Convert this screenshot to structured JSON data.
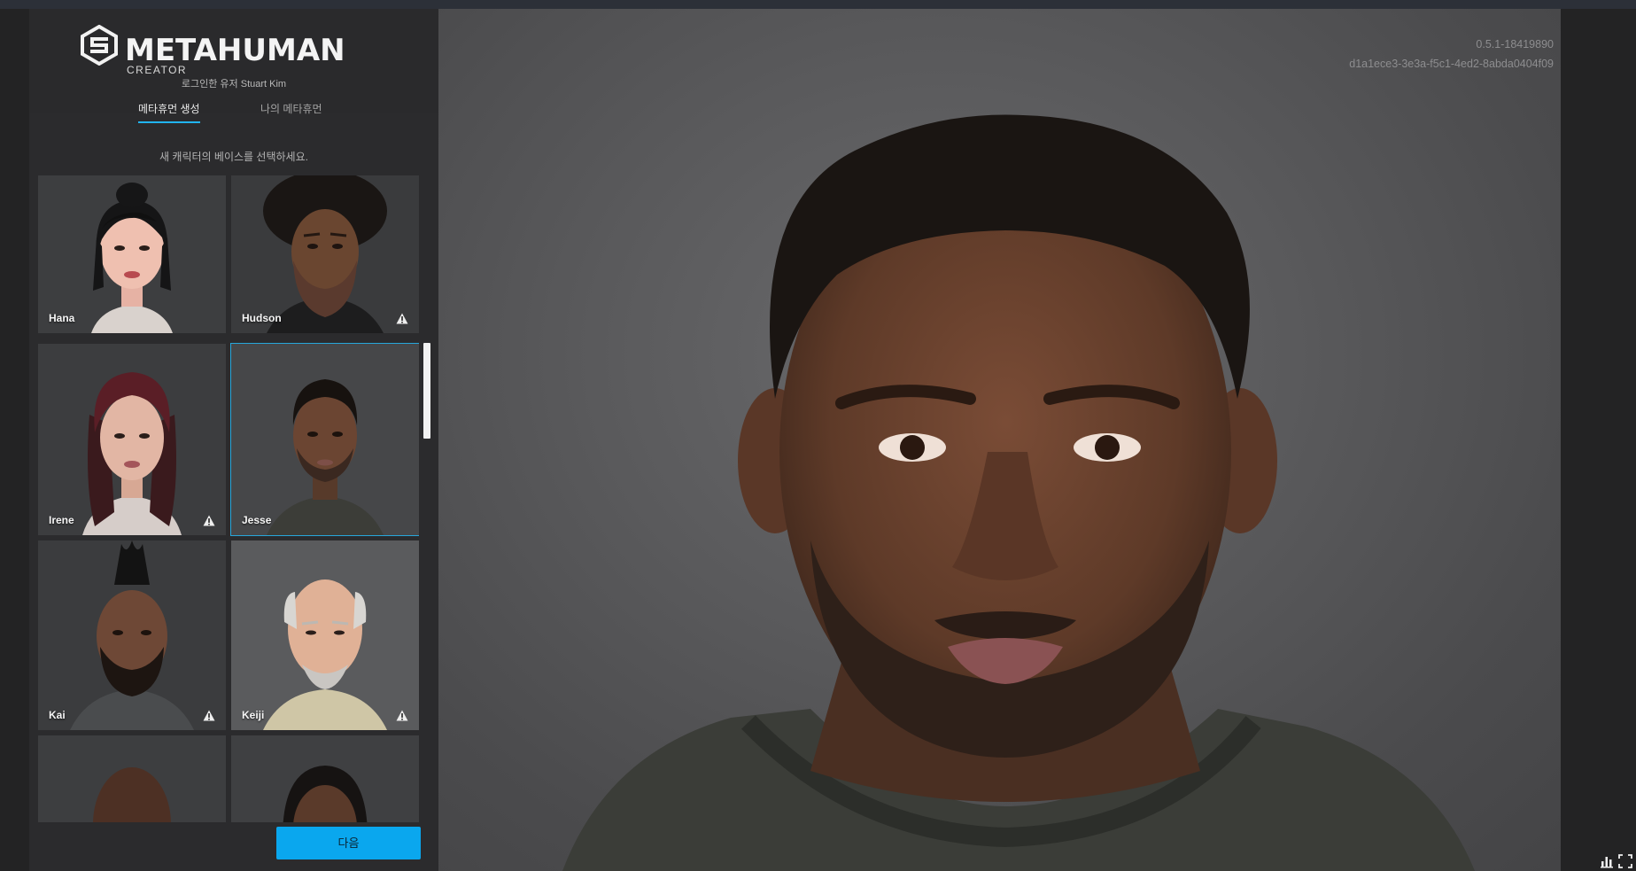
{
  "app": {
    "logo_text": "METAHUMAN",
    "logo_sub": "CREATOR",
    "login_label": "로그인한 유저",
    "user_name": "Stuart Kim"
  },
  "tabs": [
    {
      "label": "메타휴먼 생성",
      "active": true
    },
    {
      "label": "나의 메타휴먼",
      "active": false
    }
  ],
  "instruction": "새 캐릭터의 베이스를 선택하세요.",
  "presets": [
    {
      "name": "Hana",
      "warning": false,
      "selected": false
    },
    {
      "name": "Hudson",
      "warning": true,
      "selected": false
    },
    {
      "name": "Irene",
      "warning": true,
      "selected": false
    },
    {
      "name": "Jesse",
      "warning": false,
      "selected": true
    },
    {
      "name": "Kai",
      "warning": true,
      "selected": false
    },
    {
      "name": "Keiji",
      "warning": true,
      "selected": false
    },
    {
      "name": "",
      "warning": false,
      "selected": false
    },
    {
      "name": "",
      "warning": false,
      "selected": false
    }
  ],
  "next_button": "다음",
  "viewport": {
    "version": "0.5.1-18419890",
    "session_id": "d1a1ece3-3e3a-f5c1-4ed2-8abda0404f09"
  },
  "icons": {
    "warning": "warning-triangle-icon",
    "stats": "bar-chart-icon",
    "fullscreen": "fullscreen-icon"
  },
  "colors": {
    "accent": "#0aa7ee",
    "selection": "#27a7db",
    "panel": "#2b2b2d"
  }
}
